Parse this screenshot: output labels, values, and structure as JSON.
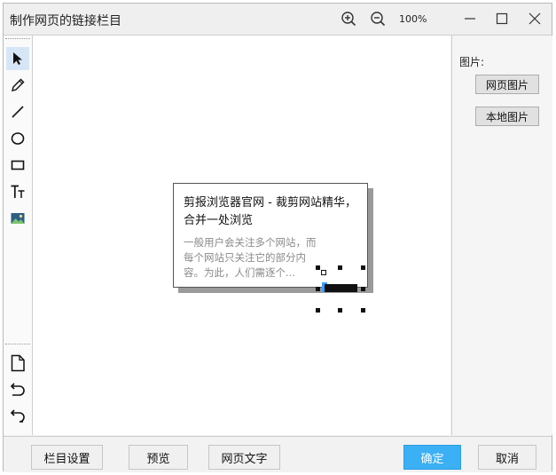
{
  "window": {
    "title": "制作网页的链接栏目",
    "zoom_in_icon": "zoom-in-icon",
    "zoom_out_icon": "zoom-out-icon",
    "zoom_level": "100%"
  },
  "toolbar": {
    "tools": [
      "cursor-icon",
      "pencil-icon",
      "line-icon",
      "ellipse-icon",
      "rectangle-icon",
      "text-icon",
      "image-icon"
    ],
    "active_tool": "cursor-icon",
    "bottom_tools": [
      "new-page-icon",
      "undo-icon",
      "redo-icon"
    ]
  },
  "canvas": {
    "card": {
      "title": "剪报浏览器官网 - 裁剪网站精华，合并一处浏览",
      "description": "一般用户会关注多个网站，而每个网站只关注它的部分内容。为此，人们需逐个..."
    }
  },
  "right_panel": {
    "label": "图片:",
    "web_image_button": "网页图片",
    "local_image_button": "本地图片"
  },
  "bottom": {
    "column_settings": "栏目设置",
    "preview": "预览",
    "web_text": "网页文字",
    "confirm": "确定",
    "cancel": "取消"
  },
  "colors": {
    "accent": "#3cb0f4",
    "active_tool_bg": "#d7e6f7"
  }
}
